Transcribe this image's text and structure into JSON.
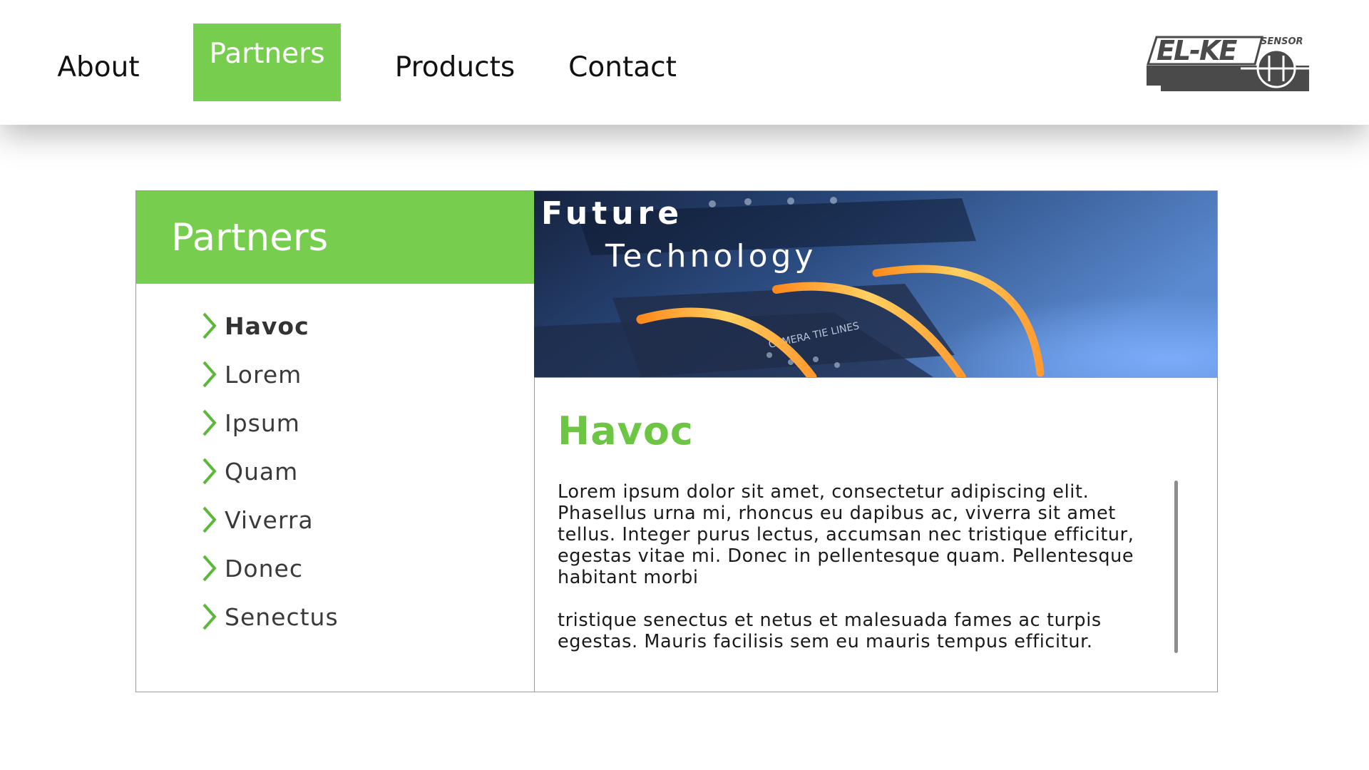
{
  "nav": {
    "items": [
      {
        "label": "About",
        "active": false
      },
      {
        "label": "Partners",
        "active": true
      },
      {
        "label": "Products",
        "active": false
      },
      {
        "label": "Contact",
        "active": false
      }
    ]
  },
  "logo": {
    "brand": "EL-KE",
    "sub": "SENSOR"
  },
  "sidebar": {
    "title": "Partners",
    "items": [
      {
        "label": "Havoc",
        "active": true
      },
      {
        "label": "Lorem",
        "active": false
      },
      {
        "label": "Ipsum",
        "active": false
      },
      {
        "label": "Quam",
        "active": false
      },
      {
        "label": "Viverra",
        "active": false
      },
      {
        "label": "Donec",
        "active": false
      },
      {
        "label": "Senectus",
        "active": false
      }
    ]
  },
  "banner": {
    "line1": "Future",
    "line2": "Technology",
    "panel_text": "CAMERA TIE LINES"
  },
  "content": {
    "title": "Havoc",
    "paragraph1": "Lorem ipsum dolor sit amet, consectetur adipiscing elit. Phasellus urna mi, rhoncus eu dapibus ac, viverra sit amet tellus. Integer purus lectus, accumsan nec tristique efficitur, egestas vitae mi. Donec in pellentesque quam. Pellentesque habitant morbi",
    "paragraph2": "tristique senectus et netus et malesuada fames ac turpis egestas. Mauris facilisis sem eu mauris tempus efficitur."
  },
  "colors": {
    "accent": "#77cd4e",
    "title_green": "#6cc643",
    "chevron": "#5cb83a"
  }
}
